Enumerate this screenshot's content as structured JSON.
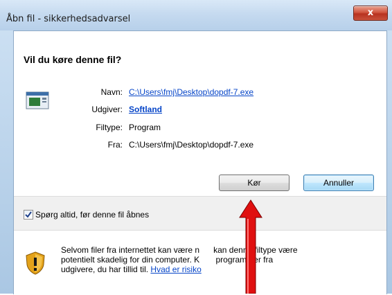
{
  "window": {
    "title": "Åbn fil - sikkerhedsadvarsel",
    "close_label": "x"
  },
  "dialog": {
    "question": "Vil du køre denne fil?",
    "fields": {
      "name_label": "Navn:",
      "name_value": "C:\\Users\\fmj\\Desktop\\dopdf-7.exe",
      "publisher_label": "Udgiver:",
      "publisher_value": "Softland",
      "type_label": "Filtype:",
      "type_value": "Program",
      "from_label": "Fra:",
      "from_value": "C:\\Users\\fmj\\Desktop\\dopdf-7.exe"
    },
    "buttons": {
      "run": "Kør",
      "cancel": "Annuller"
    },
    "checkbox": {
      "label": "Spørg altid, før denne fil åbnes",
      "checked": true
    },
    "warning": {
      "line1": "Selvom filer fra internettet kan være n",
      "line1b": "kan denne filtype være",
      "line2": "potentielt skadelig for din computer. K",
      "line2b": "programmer fra",
      "line3": "udgivere, du har tillid til.",
      "link": "Hvad er risiko"
    }
  },
  "colors": {
    "accent_link": "#0645c8",
    "arrow": "#e01010",
    "close_button": "#c8513b"
  },
  "icons": [
    "file-app-icon",
    "checkbox-check-icon",
    "warning-shield-icon",
    "red-arrow-icon"
  ]
}
